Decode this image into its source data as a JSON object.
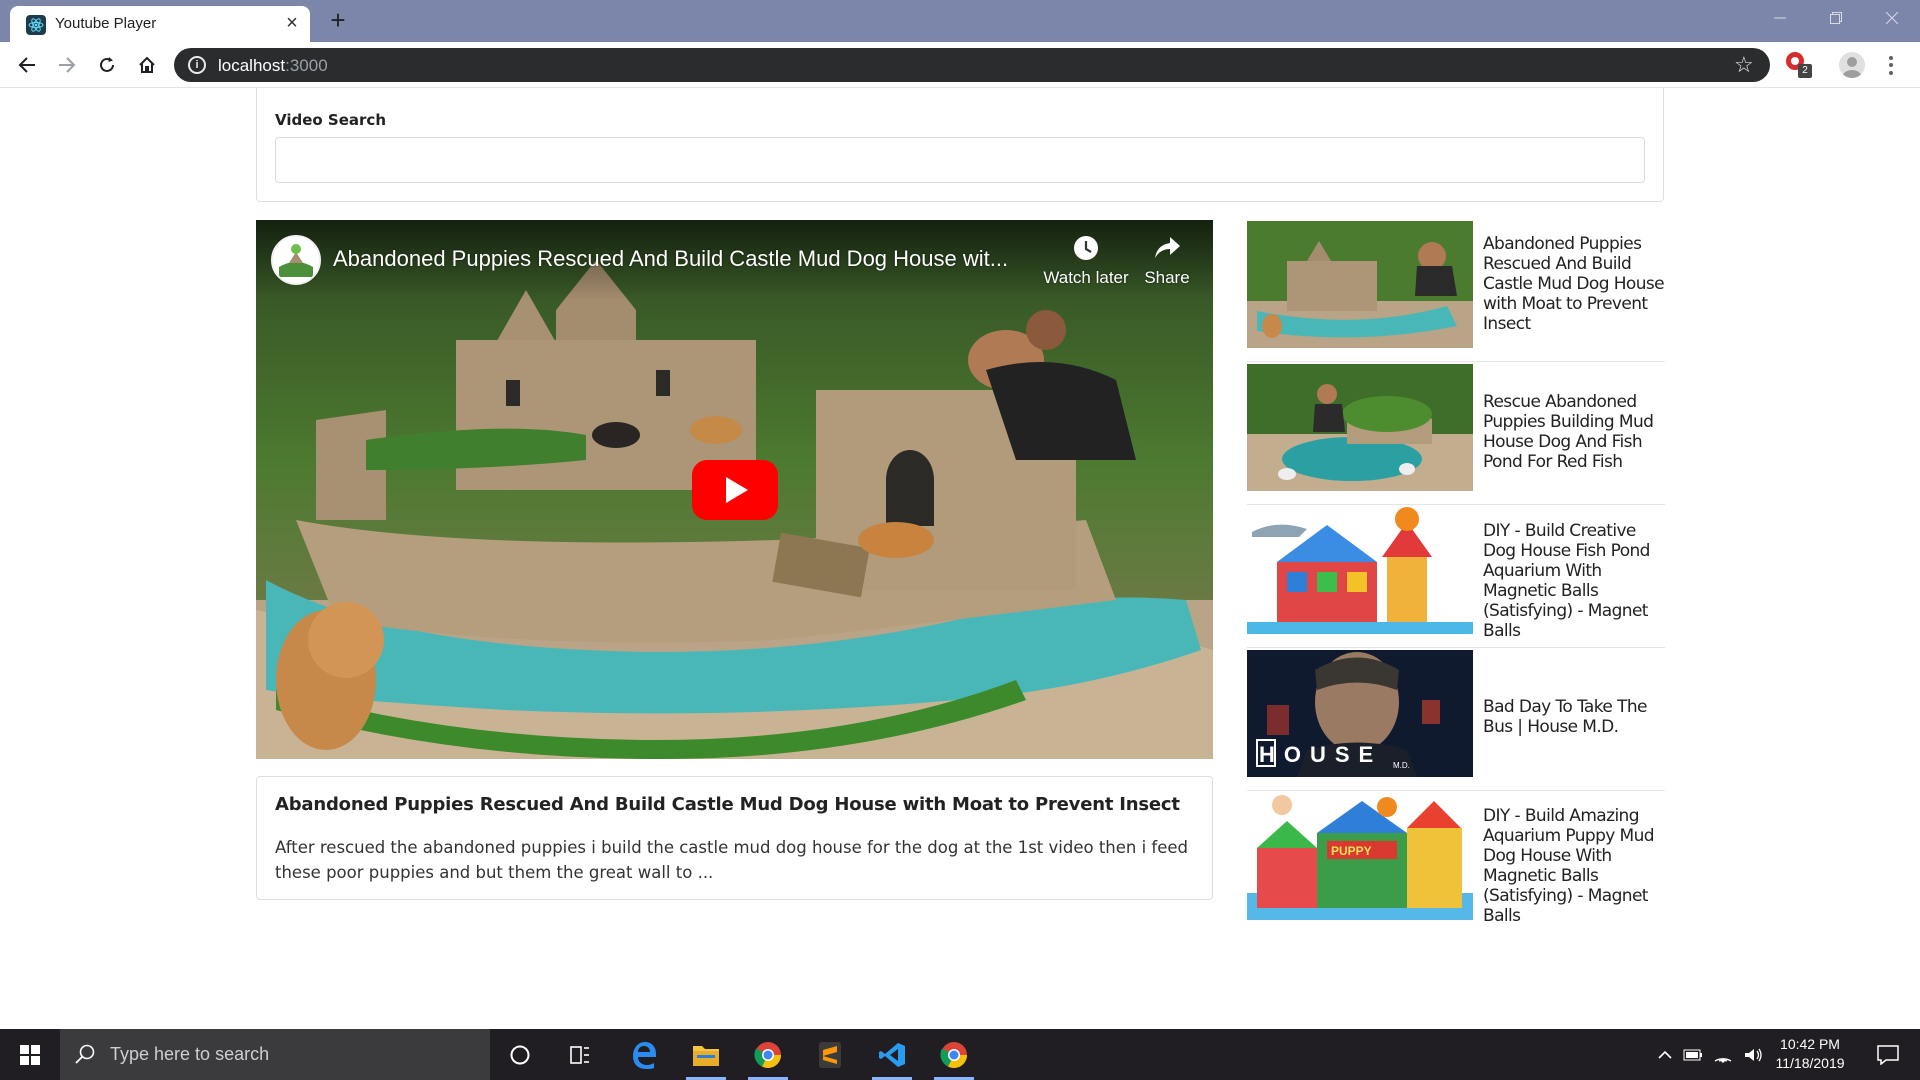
{
  "browser": {
    "tab_title": "Youtube Player",
    "url_host": "localhost",
    "url_port": ":3000",
    "extension_badge": "2"
  },
  "search": {
    "label": "Video Search",
    "value": "",
    "placeholder": ""
  },
  "player": {
    "title": "Abandoned Puppies Rescued And Build Castle Mud Dog House wit...",
    "watch_later_label": "Watch later",
    "share_label": "Share",
    "icon_names": [
      "clock-icon",
      "share-arrow-icon",
      "youtube-play-icon"
    ]
  },
  "detail": {
    "title": "Abandoned Puppies Rescued And Build Castle Mud Dog House with Moat to Prevent Insect",
    "description": "After rescued the abandoned puppies i build the castle mud dog house for the dog at the 1st video then i feed these poor puppies and but them the great wall to ..."
  },
  "video_list": [
    {
      "title": "Abandoned Puppies Rescued And Build Castle Mud Dog House with Moat to Prevent Insect"
    },
    {
      "title": "Rescue Abandoned Puppies Building Mud House Dog And Fish Pond For Red Fish"
    },
    {
      "title": "DIY - Build Creative Dog House Fish Pond Aquarium With Magnetic Balls (Satisfying) - Magnet Balls"
    },
    {
      "title": "Bad Day To Take The Bus | House M.D.",
      "thumb_text": "HOUSE",
      "thumb_subtext": "M.D."
    },
    {
      "title": "DIY - Build Amazing Aquarium Puppy Mud Dog House With Magnetic Balls (Satisfying) - Magnet Balls",
      "thumb_text": "PUPPY"
    }
  ],
  "taskbar": {
    "search_placeholder": "Type here to search",
    "time": "10:42 PM",
    "date": "11/18/2019"
  },
  "colors": {
    "tabstrip": "#7c85aa",
    "omnibox": "#2a2c2e",
    "youtube_red": "#ff0000",
    "taskbar": "#201e22"
  }
}
